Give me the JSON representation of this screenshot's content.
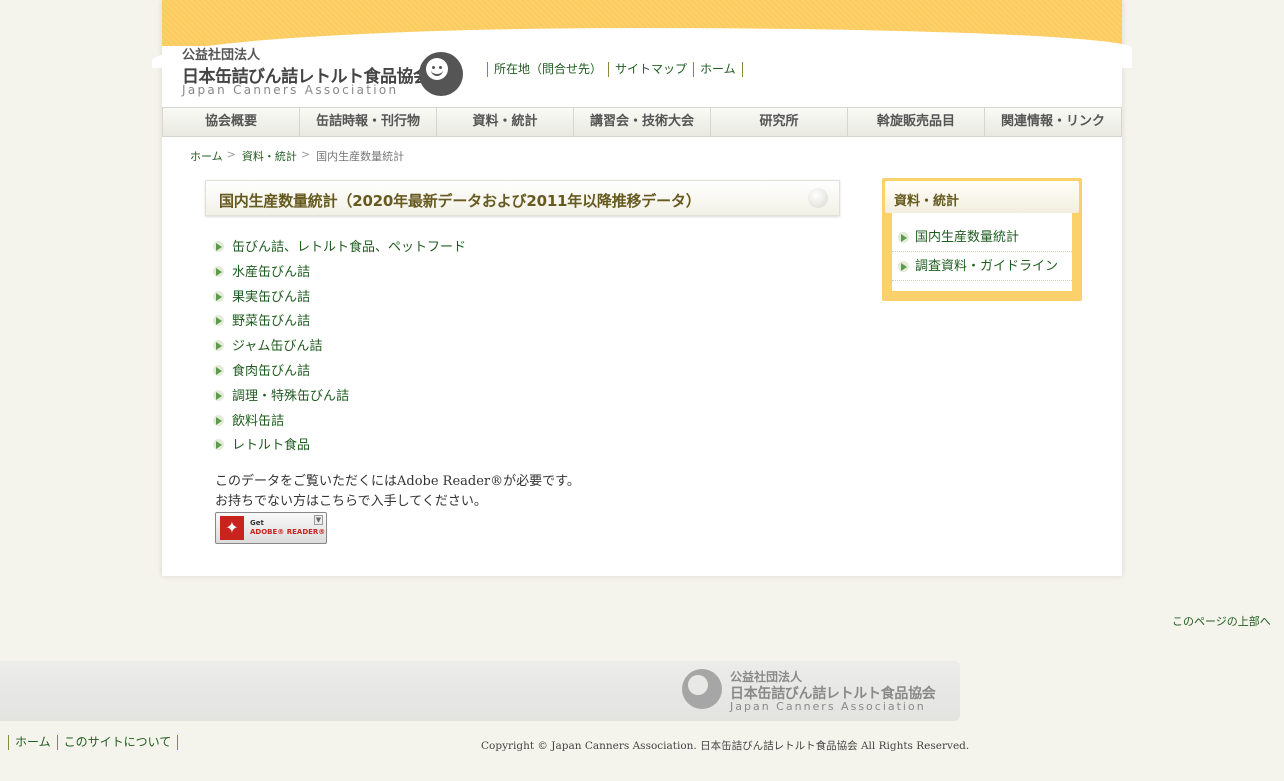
{
  "header": {
    "org_type": "公益社団法人",
    "org_name": "日本缶詰びん詰レトルト食品協会",
    "org_name_en": "Japan Canners Association",
    "util_links": [
      "所在地（問合せ先）",
      "サイトマップ",
      "ホーム"
    ]
  },
  "global_nav": [
    "協会概要",
    "缶詰時報・刊行物",
    "資料・統計",
    "講習会・技術大会",
    "研究所",
    "斡旋販売品目",
    "関連情報・リンク"
  ],
  "breadcrumb": {
    "home": "ホーム",
    "section": "資料・統計",
    "current": "国内生産数量統計",
    "sep": ">"
  },
  "main": {
    "title": "国内生産数量統計（2020年最新データおよび2011年以降推移データ）",
    "items": [
      "缶びん詰、レトルト食品、ペットフード",
      "水産缶びん詰",
      "果実缶びん詰",
      "野菜缶びん詰",
      "ジャム缶びん詰",
      "食肉缶びん詰",
      "調理・特殊缶びん詰",
      "飲料缶詰",
      "レトルト食品"
    ],
    "note_line1": "このデータをご覧いただくにはAdobe Reader®が必要です。",
    "note_line2": "お持ちでない方はこちらで入手してください。",
    "adobe_get": "Get",
    "adobe_reader": "ADOBE® READER®",
    "adobe_icon_glyph": "✦"
  },
  "sidebar": {
    "heading": "資料・統計",
    "items": [
      "国内生産数量統計",
      "調査資料・ガイドライン"
    ]
  },
  "to_top": "このページの上部へ",
  "footer": {
    "org_type": "公益社団法人",
    "org_name": "日本缶詰びん詰レトルト食品協会",
    "org_name_en": "Japan Canners Association",
    "links": [
      "ホーム",
      "このサイトについて"
    ],
    "copyright": "Copyright © Japan Canners Association. 日本缶詰びん詰レトルト食品協会 All Rights Reserved."
  },
  "colors": {
    "accent_yellow": "#fcd06a",
    "link_green": "#1f5c1f",
    "title_olive": "#665a20"
  }
}
